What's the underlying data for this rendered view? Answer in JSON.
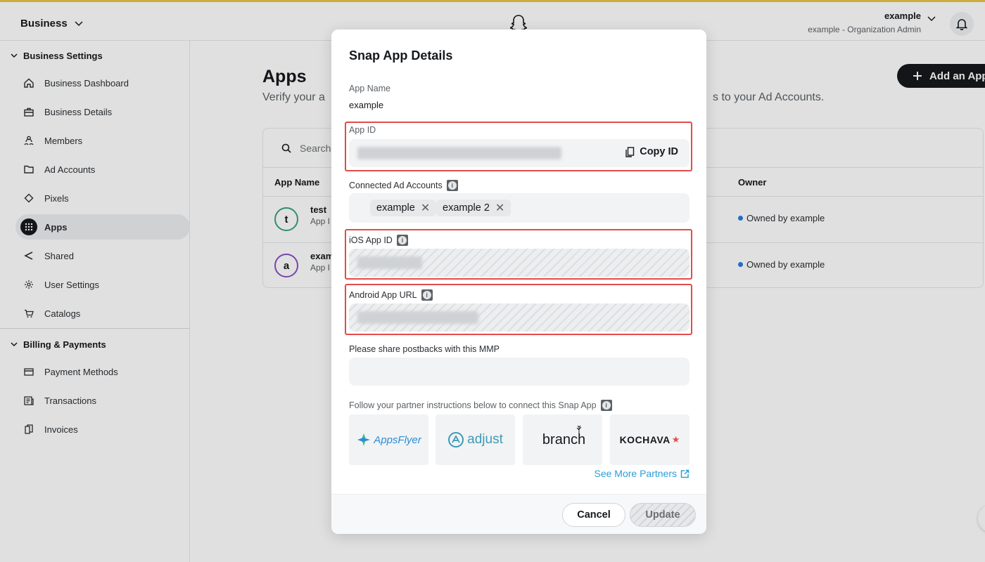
{
  "topbar": {
    "business_label": "Business",
    "user_name": "example",
    "user_role": "example - Organization Admin"
  },
  "sidebar": {
    "section1": "Business Settings",
    "items1": [
      "Business Dashboard",
      "Business Details",
      "Members",
      "Ad Accounts",
      "Pixels",
      "Apps",
      "Shared",
      "User Settings",
      "Catalogs"
    ],
    "section2": "Billing & Payments",
    "items2": [
      "Payment Methods",
      "Transactions",
      "Invoices"
    ]
  },
  "content": {
    "title": "Apps",
    "subtitle_left": "Verify your a",
    "subtitle_right": "s to your Ad Accounts.",
    "add_button": "Add an App",
    "search_placeholder": "Search",
    "col_app_name": "App Name",
    "col_owner": "Owner",
    "rows": [
      {
        "avatar": "t",
        "name": "test",
        "sub": "App I",
        "owner": "Owned by example",
        "color": "#3aa27a"
      },
      {
        "avatar": "a",
        "name": "exam",
        "sub": "App I",
        "owner": "Owned by example",
        "color": "#8a4fc2"
      }
    ]
  },
  "modal": {
    "title": "Snap App Details",
    "app_name_label": "App Name",
    "app_name_value": "example",
    "app_id_label": "App ID",
    "copy_id": "Copy ID",
    "connected_label": "Connected Ad Accounts",
    "chips": [
      "example",
      "example 2"
    ],
    "ios_label": "iOS App ID",
    "android_label": "Android App URL",
    "mmp_label": "Please share postbacks with this MMP",
    "partner_label": "Follow your partner instructions below to connect this Snap App",
    "partners": [
      "AppsFlyer",
      "adjust",
      "branch",
      "KOCHAVA"
    ],
    "see_more": "See More Partners",
    "cancel": "Cancel",
    "update": "Update"
  }
}
